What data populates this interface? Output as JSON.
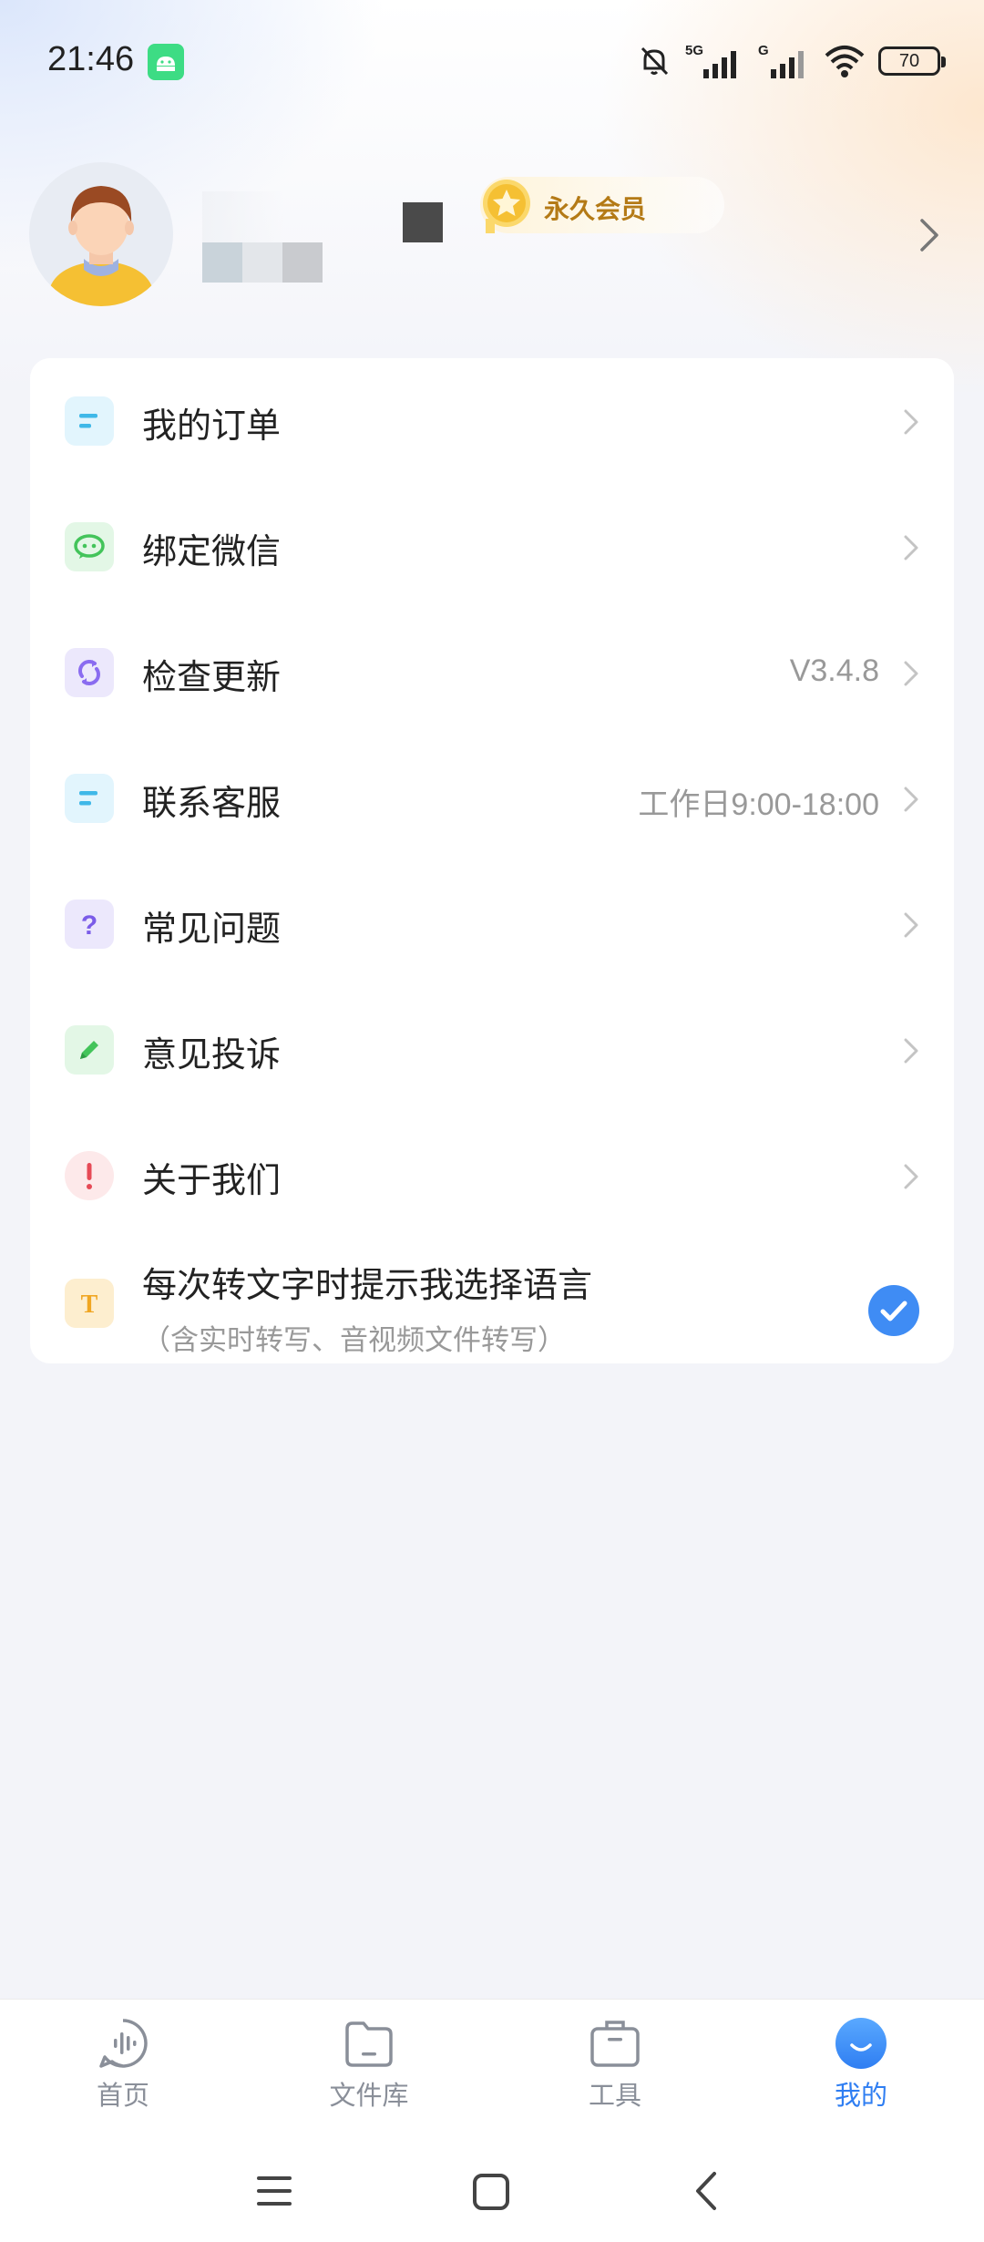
{
  "status_bar": {
    "time": "21:46",
    "battery": "70",
    "icons": [
      "android-app-icon",
      "mute-bell-icon",
      "signal-5g-icon",
      "signal-g-icon",
      "wifi-icon",
      "battery-icon"
    ]
  },
  "profile": {
    "vip_label": "永久会员"
  },
  "menu": {
    "items": [
      {
        "label": "我的订单",
        "icon": "order-icon",
        "value": ""
      },
      {
        "label": "绑定微信",
        "icon": "wechat-icon",
        "value": ""
      },
      {
        "label": "检查更新",
        "icon": "refresh-icon",
        "value": "V3.4.8"
      },
      {
        "label": "联系客服",
        "icon": "customer-service-icon",
        "value": "工作日9:00-18:00"
      },
      {
        "label": "常见问题",
        "icon": "question-icon",
        "value": ""
      },
      {
        "label": "意见投诉",
        "icon": "pencil-icon",
        "value": ""
      },
      {
        "label": "关于我们",
        "icon": "exclamation-icon",
        "value": ""
      }
    ],
    "language_prompt": {
      "label": "每次转文字时提示我选择语言",
      "sub": "（含实时转写、音视频文件转写）",
      "checked": true
    }
  },
  "bottom_nav": {
    "tabs": [
      {
        "label": "首页",
        "icon": "voice-icon",
        "active": false
      },
      {
        "label": "文件库",
        "icon": "folder-icon",
        "active": false
      },
      {
        "label": "工具",
        "icon": "toolbox-icon",
        "active": false
      },
      {
        "label": "我的",
        "icon": "smile-icon",
        "active": true
      }
    ]
  },
  "colors": {
    "accent": "#2f7ef2",
    "vip_text": "#b47a16",
    "background": "#f3f4f9"
  }
}
